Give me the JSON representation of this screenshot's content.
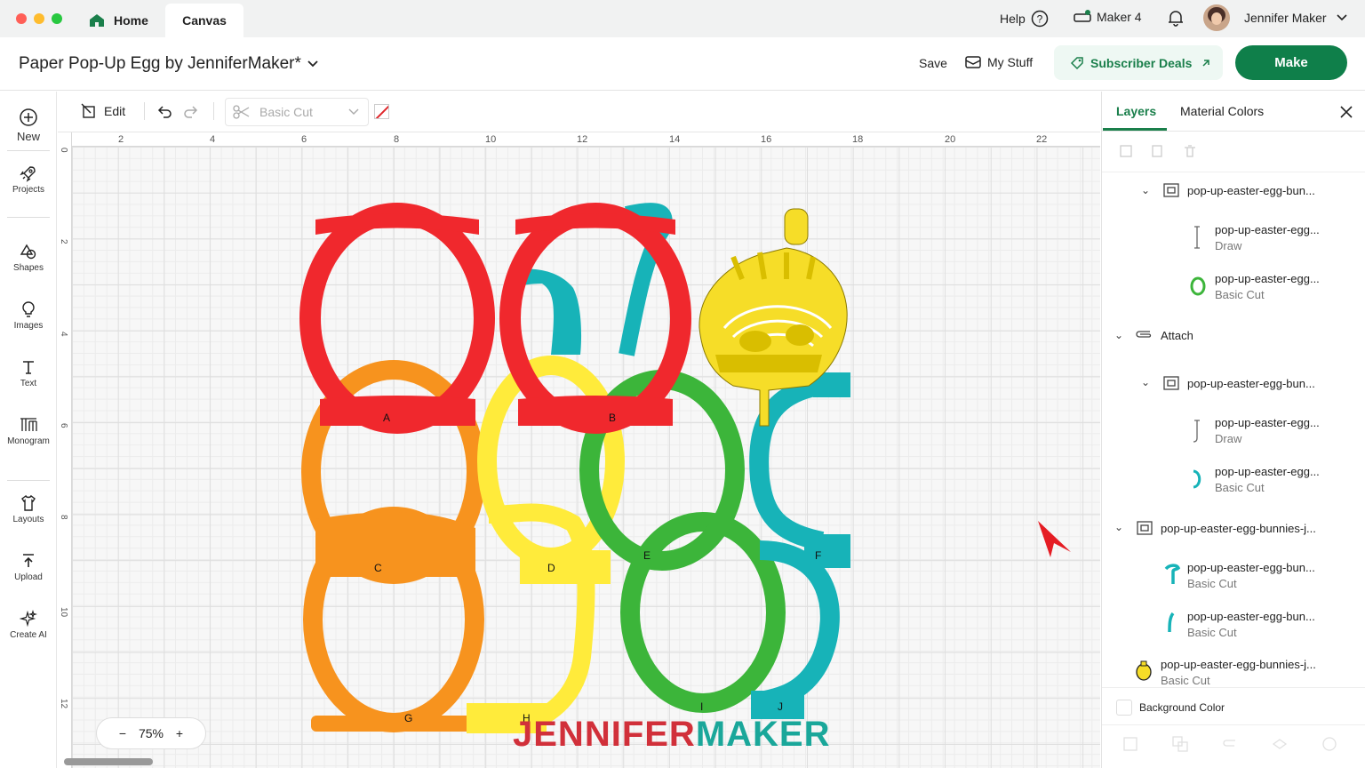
{
  "window": {
    "tabs": {
      "home": "Home",
      "canvas": "Canvas"
    },
    "help": "Help",
    "machine": "Maker 4",
    "user": "Jennifer Maker"
  },
  "header": {
    "project_title": "Paper Pop-Up Egg by JenniferMaker*",
    "save": "Save",
    "my_stuff": "My Stuff",
    "subscriber_deals": "Subscriber Deals",
    "make": "Make"
  },
  "sidebar": {
    "items": [
      {
        "label": "New",
        "icon": "plus-circle-icon"
      },
      {
        "label": "Projects",
        "icon": "rocket-icon"
      },
      {
        "label": "Shapes",
        "icon": "shapes-icon"
      },
      {
        "label": "Images",
        "icon": "lightbulb-icon"
      },
      {
        "label": "Text",
        "icon": "text-icon"
      },
      {
        "label": "Monogram",
        "icon": "monogram-icon"
      },
      {
        "label": "Layouts",
        "icon": "shirt-icon"
      },
      {
        "label": "Upload",
        "icon": "upload-icon"
      },
      {
        "label": "Create AI",
        "icon": "sparkle-icon"
      }
    ]
  },
  "toolbar": {
    "edit": "Edit",
    "operation": "Basic Cut"
  },
  "ruler": {
    "top": [
      "2",
      "4",
      "6",
      "8",
      "10",
      "12",
      "14",
      "16",
      "18",
      "20",
      "22"
    ],
    "left": [
      "0",
      "2",
      "4",
      "6",
      "8",
      "10",
      "12"
    ]
  },
  "canvas": {
    "zoom": "75%",
    "watermark_left": "JENNIFER",
    "watermark_right": "MAKER",
    "piece_letters": [
      "A",
      "B",
      "C",
      "D",
      "E",
      "F",
      "G",
      "H",
      "I",
      "J"
    ],
    "colors": {
      "red": "#f0282d",
      "orange": "#f7931e",
      "yellow": "#ffeb3b",
      "green": "#3cb53a",
      "teal": "#17b3b8",
      "gold": "#f6dd28"
    }
  },
  "layers_panel": {
    "tabs": {
      "layers": "Layers",
      "material_colors": "Material Colors"
    },
    "rows": [
      {
        "name": "pop-up-easter-egg-bun...",
        "type": ""
      },
      {
        "name": "pop-up-easter-egg...",
        "type": "Draw"
      },
      {
        "name": "pop-up-easter-egg...",
        "type": "Basic Cut"
      },
      {
        "name": "Attach",
        "type": ""
      },
      {
        "name": "pop-up-easter-egg-bun...",
        "type": ""
      },
      {
        "name": "pop-up-easter-egg...",
        "type": "Draw"
      },
      {
        "name": "pop-up-easter-egg...",
        "type": "Basic Cut"
      },
      {
        "name": "pop-up-easter-egg-bunnies-j...",
        "type": ""
      },
      {
        "name": "pop-up-easter-egg-bun...",
        "type": "Basic Cut"
      },
      {
        "name": "pop-up-easter-egg-bun...",
        "type": "Basic Cut"
      },
      {
        "name": "pop-up-easter-egg-bunnies-j...",
        "type": "Basic Cut"
      }
    ],
    "background_color": "Background Color"
  },
  "colors": {
    "accent": "#1a7f4b",
    "make_button": "#0f7f4a",
    "deals_bg": "#eef8f3"
  }
}
